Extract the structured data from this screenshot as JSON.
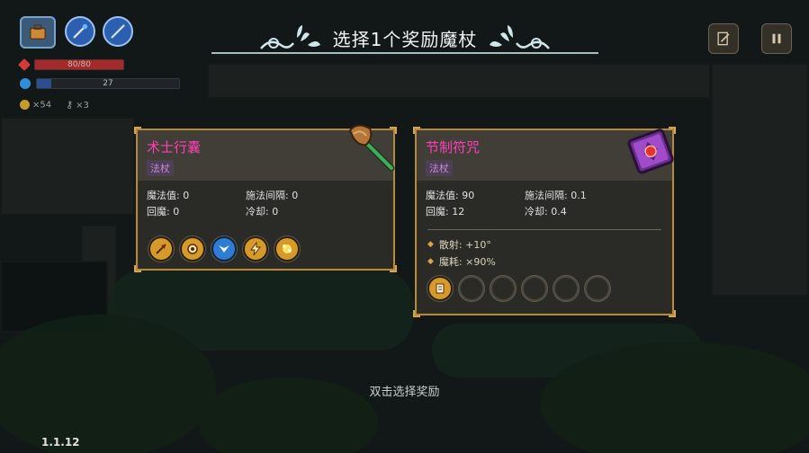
{
  "title": "选择1个奖励魔杖",
  "hint": "双击选择奖励",
  "version": "1.1.12",
  "hud": {
    "hp_text": "80/80",
    "hp_fraction": 1.0,
    "mana_text": "27",
    "mana_fraction": 0.1,
    "gold": "×54",
    "keys": "×3"
  },
  "cards": [
    {
      "name": "术士行囊",
      "tag": "法杖",
      "stats": [
        {
          "label": "魔法值: 0"
        },
        {
          "label": "施法间隔: 0"
        },
        {
          "label": "回魔: 0"
        },
        {
          "label": "冷却: 0"
        }
      ],
      "icon": "broom-wand-icon",
      "spells": [
        {
          "icon": "arrow-spell-icon",
          "color": "gold"
        },
        {
          "icon": "gear-spell-icon",
          "color": "gold"
        },
        {
          "icon": "wing-spell-icon",
          "color": "blue"
        },
        {
          "icon": "lightning-spell-icon",
          "color": "gold"
        },
        {
          "icon": "burst-spell-icon",
          "color": "gold"
        }
      ]
    },
    {
      "name": "节制符咒",
      "tag": "法杖",
      "stats": [
        {
          "label": "魔法值: 90"
        },
        {
          "label": "施法间隔: 0.1"
        },
        {
          "label": "回魔: 12"
        },
        {
          "label": "冷却: 0.4"
        }
      ],
      "mods": [
        {
          "label": "散射: +10°"
        },
        {
          "label": "魔耗: ×90%"
        }
      ],
      "icon": "spellbook-icon",
      "spells": [
        {
          "icon": "scroll-spell-icon",
          "color": "gold"
        },
        {
          "icon": "empty-slot",
          "color": "empty"
        },
        {
          "icon": "empty-slot",
          "color": "empty"
        },
        {
          "icon": "empty-slot",
          "color": "empty"
        },
        {
          "icon": "empty-slot",
          "color": "empty"
        },
        {
          "icon": "empty-slot",
          "color": "empty"
        }
      ]
    }
  ],
  "colors": {
    "card_name": "#ff3fb8",
    "card_border": "#b68a3c",
    "tag": "#c689d4"
  }
}
